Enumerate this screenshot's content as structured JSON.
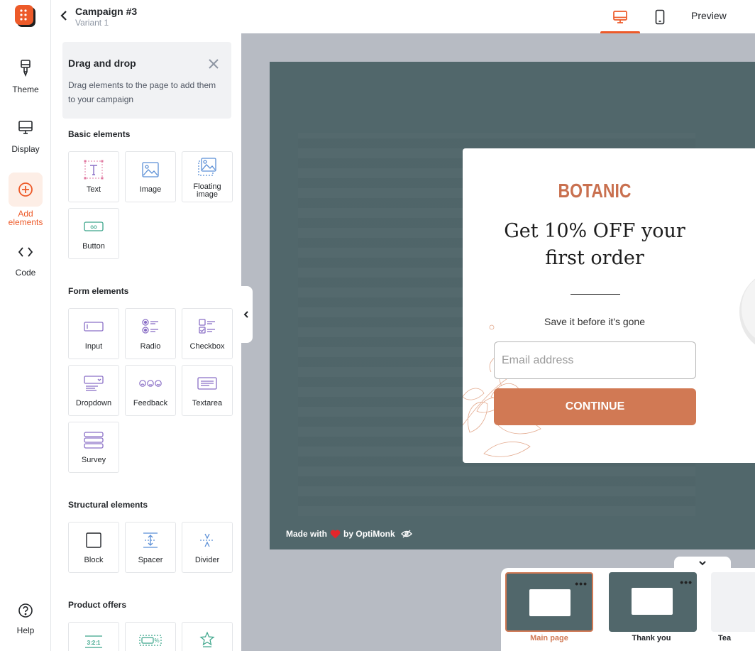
{
  "rail": {
    "items": [
      {
        "label": "Theme"
      },
      {
        "label": "Display"
      },
      {
        "label_line1": "Add",
        "label_line2": "elements"
      },
      {
        "label": "Code"
      },
      {
        "label": "Help"
      }
    ]
  },
  "header": {
    "campaign_title": "Campaign #3",
    "variant": "Variant 1",
    "preview_label": "Preview"
  },
  "tip": {
    "title": "Drag and drop",
    "text": "Drag elements to the page to add them to your campaign"
  },
  "sections": {
    "basic": {
      "title": "Basic elements",
      "items": [
        "Text",
        "Image",
        "Floating image",
        "Button"
      ]
    },
    "form": {
      "title": "Form elements",
      "items": [
        "Input",
        "Radio",
        "Checkbox",
        "Dropdown",
        "Feedback",
        "Textarea",
        "Survey"
      ]
    },
    "structural": {
      "title": "Structural elements",
      "items": [
        "Block",
        "Spacer",
        "Divider"
      ]
    },
    "product": {
      "title": "Product offers"
    }
  },
  "popup": {
    "brand": "BOTANIC",
    "headline_line1": "Get 10% OFF your",
    "headline_line2": "first order",
    "subtext": "Save it before it's gone",
    "email_placeholder": "Email address",
    "cta_label": "CONTINUE"
  },
  "footer": {
    "made_with": "Made with",
    "by": "by OptiMonk"
  },
  "pages": [
    {
      "label": "Main page",
      "active": true
    },
    {
      "label": "Thank you",
      "active": false
    },
    {
      "label": "Tea",
      "active": false
    }
  ],
  "colors": {
    "accent": "#ed5a29",
    "brand": "#c9704f",
    "cta": "#d17954",
    "stage": "#51676b",
    "canvas": "#b7bbc3"
  }
}
